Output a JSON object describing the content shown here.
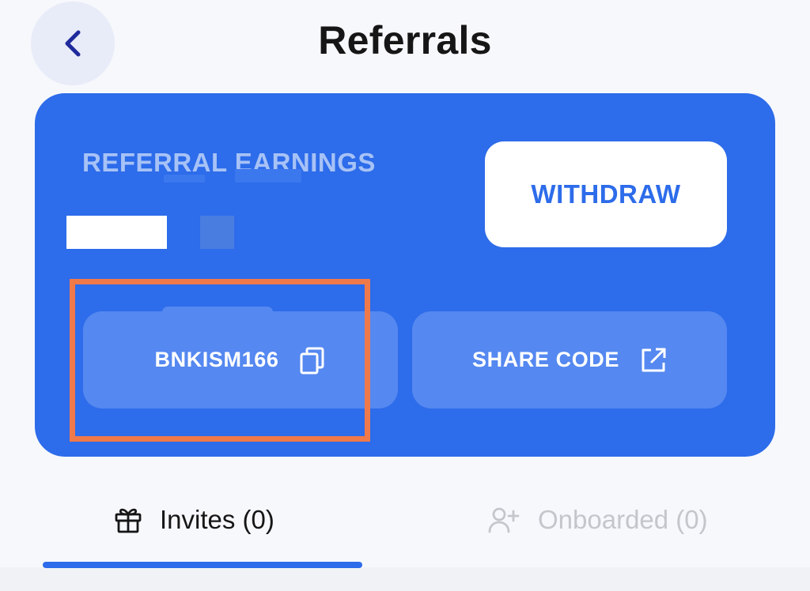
{
  "header": {
    "title": "Referrals",
    "back_icon": "chevron-left-icon"
  },
  "earnings": {
    "label": "REFERRAL EARNINGS",
    "withdraw_label": "WITHDRAW",
    "referral_code": "BNKISM166",
    "copy_icon": "copy-icon",
    "share_label": "SHARE CODE",
    "share_icon": "external-link-icon"
  },
  "tabs": [
    {
      "label": "Invites (0)",
      "icon": "gift-icon",
      "active": true
    },
    {
      "label": "Onboarded (0)",
      "icon": "user-plus-icon",
      "active": false
    }
  ],
  "colors": {
    "accent": "#2d6cea",
    "card_button": "#5588f0",
    "highlight": "#f0794a",
    "inactive_text": "#c4c6cc",
    "background": "#f7f8fc"
  }
}
